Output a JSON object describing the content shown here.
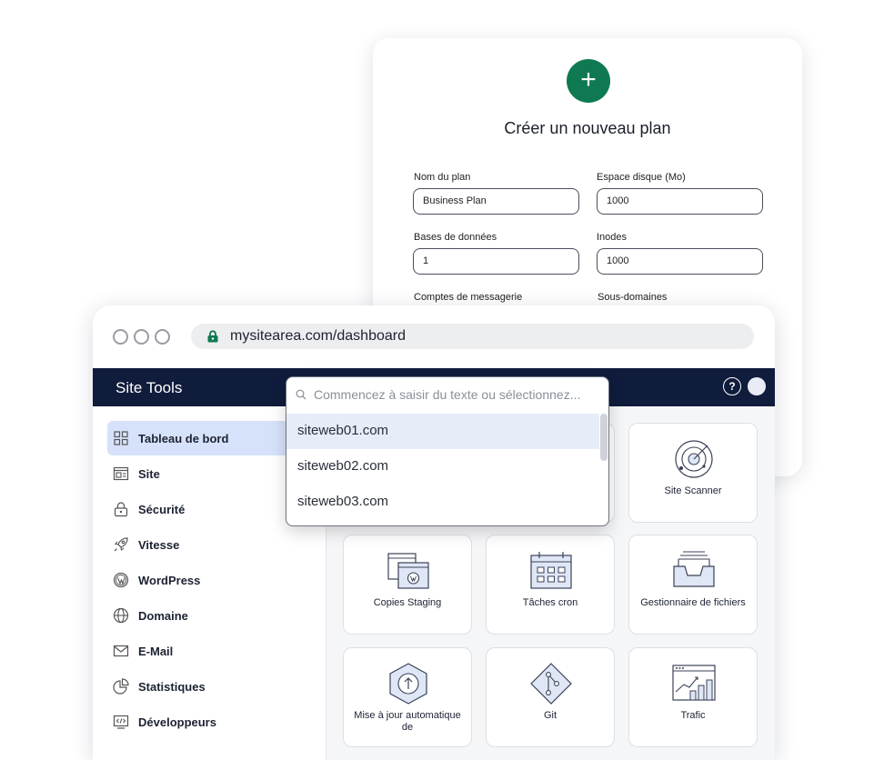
{
  "plan_form": {
    "title": "Créer un nouveau plan",
    "fields": [
      {
        "label": "Nom du plan",
        "value": "Business Plan"
      },
      {
        "label": "Espace disque (Mo)",
        "value": "1000"
      },
      {
        "label": "Bases de données",
        "value": "1"
      },
      {
        "label": "Inodes",
        "value": "1000"
      },
      {
        "label": "Comptes de messagerie",
        "value": ""
      },
      {
        "label": "Sous-domaines",
        "value": ""
      }
    ]
  },
  "browser": {
    "url": "mysitearea.com/dashboard"
  },
  "topnav": {
    "brand": "Site Tools"
  },
  "sidebar": {
    "items": [
      {
        "label": "Tableau de bord",
        "icon": "dashboard-icon",
        "active": true
      },
      {
        "label": "Site",
        "icon": "site-icon"
      },
      {
        "label": "Sécurité",
        "icon": "lock-icon"
      },
      {
        "label": "Vitesse",
        "icon": "rocket-icon"
      },
      {
        "label": "WordPress",
        "icon": "wordpress-icon"
      },
      {
        "label": "Domaine",
        "icon": "globe-icon"
      },
      {
        "label": "E-Mail",
        "icon": "mail-icon"
      },
      {
        "label": "Statistiques",
        "icon": "pie-chart-icon"
      },
      {
        "label": "Développeurs",
        "icon": "code-icon"
      }
    ]
  },
  "tools": {
    "tiles": [
      {
        "label": "Site Scanner",
        "icon": "radar-icon"
      },
      {
        "label": "Copies Staging",
        "icon": "staging-icon"
      },
      {
        "label": "Tâches cron",
        "icon": "calendar-icon"
      },
      {
        "label": "Gestionnaire de fichiers",
        "icon": "file-tray-icon"
      },
      {
        "label": "Mise à jour automatique de",
        "icon": "update-arrow-icon"
      },
      {
        "label": "Git",
        "icon": "git-icon"
      },
      {
        "label": "Trafic",
        "icon": "traffic-chart-icon"
      }
    ]
  },
  "site_select": {
    "placeholder": "Commencez à saisir du texte ou sélectionnez...",
    "options": [
      "siteweb01.com",
      "siteweb02.com",
      "siteweb03.com"
    ],
    "selected": "siteweb01.com"
  },
  "colors": {
    "accent_green": "#0f7a52",
    "nav_navy": "#101c3c",
    "active_item": "#d6e2fa"
  }
}
